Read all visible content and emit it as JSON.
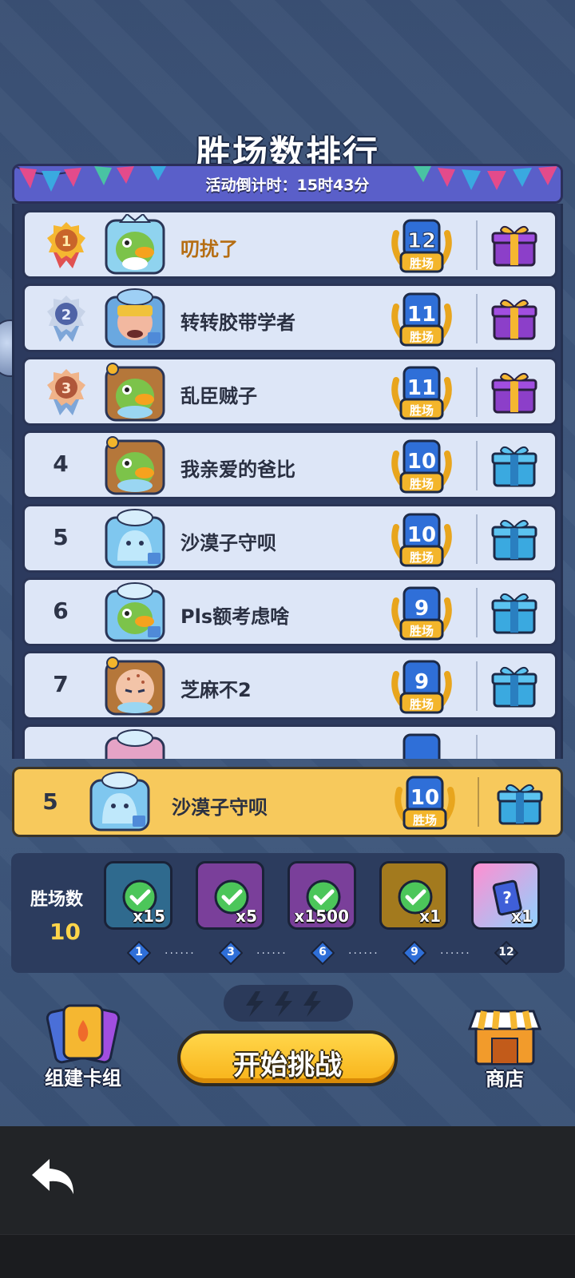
{
  "title": "胜场数排行",
  "countdown": "活动倒计时：15时43分",
  "wins_unit": "胜场",
  "leaderboard": [
    {
      "rank": "1",
      "name": "叨扰了",
      "wins": "12",
      "medal": "gold-medal-icon",
      "gift": "purple-gift-icon",
      "avatar": "frog-avatar"
    },
    {
      "rank": "2",
      "name": "转转胶带学者",
      "wins": "11",
      "medal": "silver-medal-icon",
      "gift": "purple-gift-icon",
      "avatar": "knight-avatar"
    },
    {
      "rank": "3",
      "name": "乱臣贼子",
      "wins": "11",
      "medal": "bronze-medal-icon",
      "gift": "purple-gift-icon",
      "avatar": "frog-avatar"
    },
    {
      "rank": "4",
      "name": "我亲爱的爸比",
      "wins": "10",
      "gift": "blue-gift-icon",
      "avatar": "frog-avatar"
    },
    {
      "rank": "5",
      "name": "沙漠子守呗",
      "wins": "10",
      "gift": "blue-gift-icon",
      "avatar": "ghost-avatar"
    },
    {
      "rank": "6",
      "name": "Pls额考虑啥",
      "wins": "9",
      "gift": "blue-gift-icon",
      "avatar": "frog-avatar"
    },
    {
      "rank": "7",
      "name": "芝麻不2",
      "wins": "9",
      "gift": "blue-gift-icon",
      "avatar": "monk-avatar"
    }
  ],
  "my_entry": {
    "rank": "5",
    "name": "沙漠子守呗",
    "wins": "10",
    "gift": "blue-gift-icon"
  },
  "progress": {
    "label": "胜场数",
    "value": "10",
    "rewards": [
      {
        "qty": "x15",
        "color": "#2f6a8e",
        "claimed": true
      },
      {
        "qty": "x5",
        "color": "#7a3f9a",
        "claimed": true
      },
      {
        "qty": "x1500",
        "color": "#7a3f9a",
        "claimed": true
      },
      {
        "qty": "x1",
        "color": "#a37a1e",
        "claimed": true
      },
      {
        "qty": "x1",
        "color": "#d36bd0",
        "claimed": false
      }
    ],
    "milestones": [
      "1",
      "3",
      "6",
      "9",
      "12"
    ]
  },
  "buttons": {
    "start": "开始挑战",
    "deck": "组建卡组",
    "shop": "商店"
  },
  "colors": {
    "accent": "#f8b319",
    "highlight_row": "#f7c95c",
    "row_bg": "#dde6f7",
    "banner": "#5a5fc9"
  }
}
